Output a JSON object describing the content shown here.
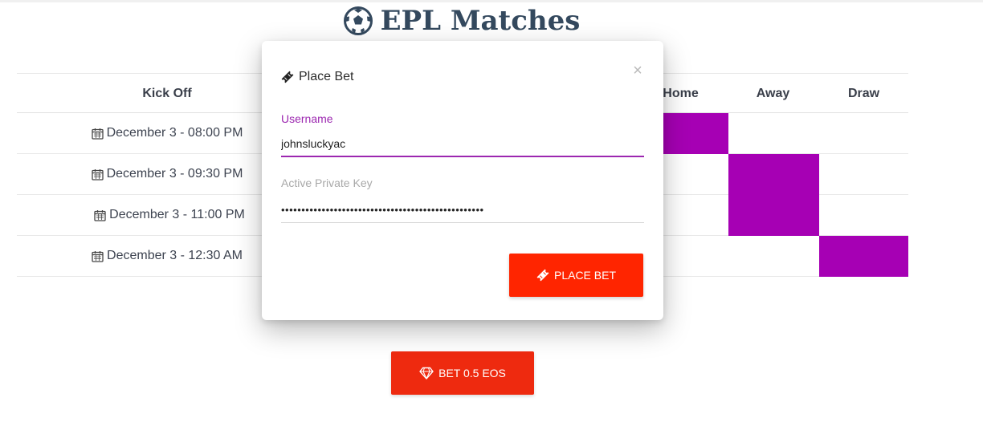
{
  "page": {
    "title": "EPL Matches",
    "title_icon": "soccer-ball-icon"
  },
  "table": {
    "headers": {
      "kickoff": "Kick Off",
      "home": "Home",
      "away": "Away",
      "draw": "Draw"
    },
    "rows": [
      {
        "kickoff": "December 3 - 08:00 PM",
        "selected": "home"
      },
      {
        "kickoff": "December 3 - 09:30 PM",
        "selected": "away"
      },
      {
        "kickoff": "December 3 - 11:00 PM",
        "selected": "away"
      },
      {
        "kickoff": "December 3 - 12:30 AM",
        "selected": "draw"
      }
    ],
    "row_icon": "calendar-icon",
    "selection_color": "#a600b4"
  },
  "bet_button": {
    "label": "BET 0.5 EOS",
    "icon": "diamond-icon",
    "color": "#ee2a0f"
  },
  "modal": {
    "title": "Place Bet",
    "title_icon": "ticket-icon",
    "close_label": "×",
    "username": {
      "label": "Username",
      "value": "johnsluckyac"
    },
    "private_key": {
      "label": "Active Private Key",
      "value": "••••••••••••••••••••••••••••••••••••••••••••••••••"
    },
    "submit": {
      "label": "PLACE BET",
      "icon": "ticket-icon",
      "color": "#ff2500"
    },
    "accent_color": "#9c27b0"
  }
}
